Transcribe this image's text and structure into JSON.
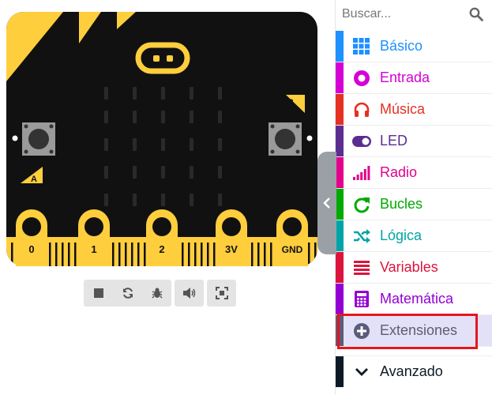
{
  "search": {
    "placeholder": "Buscar..."
  },
  "board": {
    "buttons": [
      "A",
      "B"
    ],
    "pins": [
      "0",
      "1",
      "2",
      "3V",
      "GND"
    ]
  },
  "toolbar": {
    "icons": [
      "stop-icon",
      "restart-icon",
      "debug-icon",
      "sound-icon",
      "fullscreen-icon"
    ]
  },
  "toolbox": {
    "categories": [
      {
        "label": "Básico",
        "color": "#1e90ff",
        "icon": "grid-icon"
      },
      {
        "label": "Entrada",
        "color": "#d400d4",
        "icon": "circle-dot-icon"
      },
      {
        "label": "Música",
        "color": "#e63022",
        "icon": "headphones-icon"
      },
      {
        "label": "LED",
        "color": "#5c2d91",
        "icon": "toggle-icon"
      },
      {
        "label": "Radio",
        "color": "#e3008c",
        "icon": "signal-bars-icon"
      },
      {
        "label": "Bucles",
        "color": "#00aa00",
        "icon": "refresh-icon"
      },
      {
        "label": "Lógica",
        "color": "#00a4a6",
        "icon": "shuffle-icon"
      },
      {
        "label": "Variables",
        "color": "#dc143c",
        "icon": "lines-icon"
      },
      {
        "label": "Matemática",
        "color": "#9400d3",
        "icon": "calculator-icon"
      },
      {
        "label": "Extensiones",
        "color": "#5c5c7a",
        "icon": "plus-circle-icon"
      }
    ],
    "advanced": {
      "label": "Avanzado",
      "color": "#0d1a26",
      "icon": "chevron-down-icon"
    }
  },
  "colors": {
    "board_yellow": "#ffce3d",
    "board_black": "#111111",
    "highlight": "#e8141e"
  }
}
